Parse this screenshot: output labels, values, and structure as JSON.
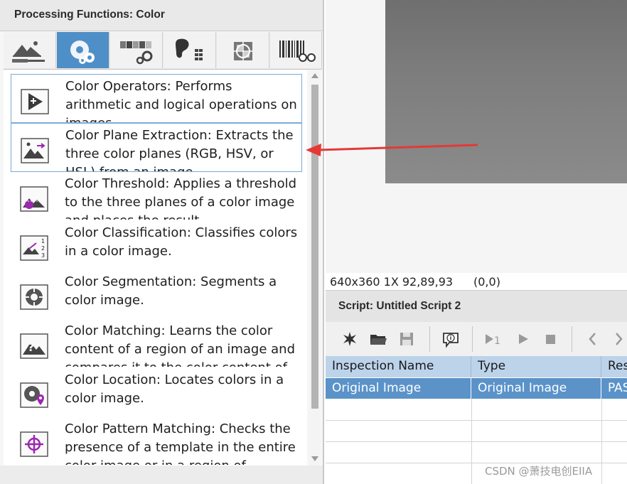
{
  "panel": {
    "title": "Processing Functions: Color",
    "tabs": [
      {
        "icon": "image-processing-icon",
        "active": false
      },
      {
        "icon": "color-gears-icon",
        "active": true
      },
      {
        "icon": "grayscale-gears-icon",
        "active": false
      },
      {
        "icon": "binary-grid-icon",
        "active": false
      },
      {
        "icon": "machine-vision-icon",
        "active": false
      },
      {
        "icon": "barcode-glasses-icon",
        "active": false
      }
    ],
    "items": [
      {
        "label": "Color Operators:  Performs arithmetic and logical operations on images.",
        "icon": "color-operators-icon"
      },
      {
        "label": "Color Plane Extraction:  Extracts the three color planes (RGB, HSV, or HSL) from an image.",
        "icon": "color-plane-extraction-icon"
      },
      {
        "label": "Color Threshold:  Applies a threshold to the three planes of a color image and places the result",
        "icon": "color-threshold-icon"
      },
      {
        "label": "Color Classification:  Classifies colors in a color image.",
        "icon": "color-classification-icon"
      },
      {
        "label": "Color Segmentation:  Segments a color image.",
        "icon": "color-segmentation-icon"
      },
      {
        "label": "Color Matching:  Learns the color content of a region of an image and compares it to the color content of",
        "icon": "color-matching-icon"
      },
      {
        "label": "Color Location:  Locates colors in a color image.",
        "icon": "color-location-icon"
      },
      {
        "label": "Color Pattern Matching:  Checks the presence of a template in the entire color image or in a region of",
        "icon": "color-pattern-matching-icon"
      }
    ]
  },
  "image_view": {
    "dims": "640x360 1X 92,89,93",
    "coord": "(0,0)"
  },
  "script": {
    "title": "Script: Untitled Script 2",
    "toolbar": [
      "new-icon",
      "open-folder-icon",
      "save-icon",
      "info-icon",
      "run-once-icon",
      "run-icon",
      "stop-icon",
      "prev-icon",
      "next-icon"
    ],
    "columns": [
      "Inspection Name",
      "Type",
      "Res"
    ],
    "rows": [
      [
        "Original Image",
        "Original Image",
        "PAS"
      ]
    ]
  },
  "watermark": "CSDN @萧技电创EIIA",
  "colors": {
    "accent_tab": "#4f8fc7",
    "selected_row": "#5b93c9",
    "header_row": "#bcd3ea",
    "annotation_arrow": "#e53935"
  }
}
